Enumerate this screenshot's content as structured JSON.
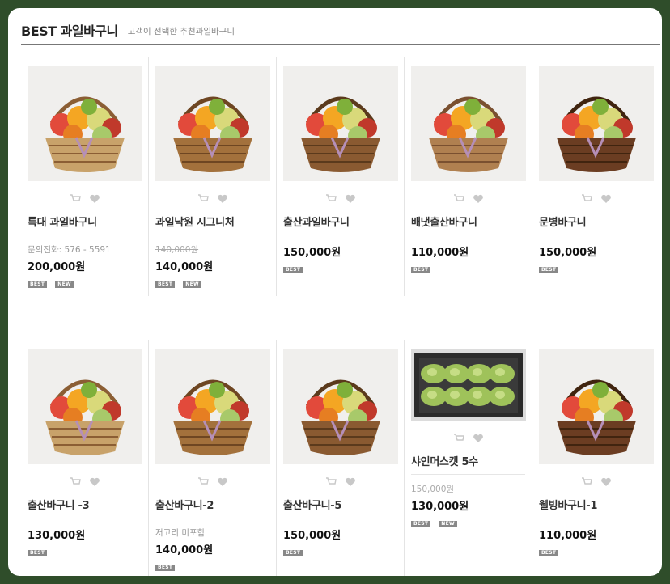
{
  "header": {
    "title": "BEST 과일바구니",
    "subtitle": "고객이 선택한 추천과일바구니"
  },
  "badges": {
    "best": "BEST",
    "new": "NEW"
  },
  "products": [
    {
      "name": "특대 과일바구니",
      "info": "문의전화: 576 - 5591",
      "price": "200,000원",
      "badges": [
        "BEST",
        "NEW"
      ]
    },
    {
      "name": "과일낙원 시그니처",
      "original_price": "140,000원",
      "price": "140,000원",
      "badges": [
        "BEST",
        "NEW"
      ]
    },
    {
      "name": "출산과일바구니",
      "price": "150,000원",
      "badges": [
        "BEST"
      ]
    },
    {
      "name": "배냇출산바구니",
      "price": "110,000원",
      "badges": [
        "BEST"
      ]
    },
    {
      "name": "문병바구니",
      "price": "150,000원",
      "badges": [
        "BEST"
      ]
    },
    {
      "name": "출산바구니 -3",
      "price": "130,000원",
      "badges": [
        "BEST"
      ]
    },
    {
      "name": "출산바구니-2",
      "info": "저고리 미포함",
      "price": "140,000원",
      "badges": [
        "BEST"
      ]
    },
    {
      "name": "출산바구니-5",
      "price": "150,000원",
      "badges": [
        "BEST"
      ]
    },
    {
      "name": "샤인머스캣 5수",
      "original_price": "150,000원",
      "price": "130,000원",
      "badges": [
        "BEST",
        "NEW"
      ]
    },
    {
      "name": "웰빙바구니-1",
      "price": "110,000원",
      "badges": [
        "BEST"
      ]
    }
  ],
  "icons": {
    "cart": "cart-icon",
    "wishlist": "heart-icon"
  },
  "colors": {
    "frame": "#2f4d2a",
    "badge": "#888888",
    "price": "#111111"
  }
}
